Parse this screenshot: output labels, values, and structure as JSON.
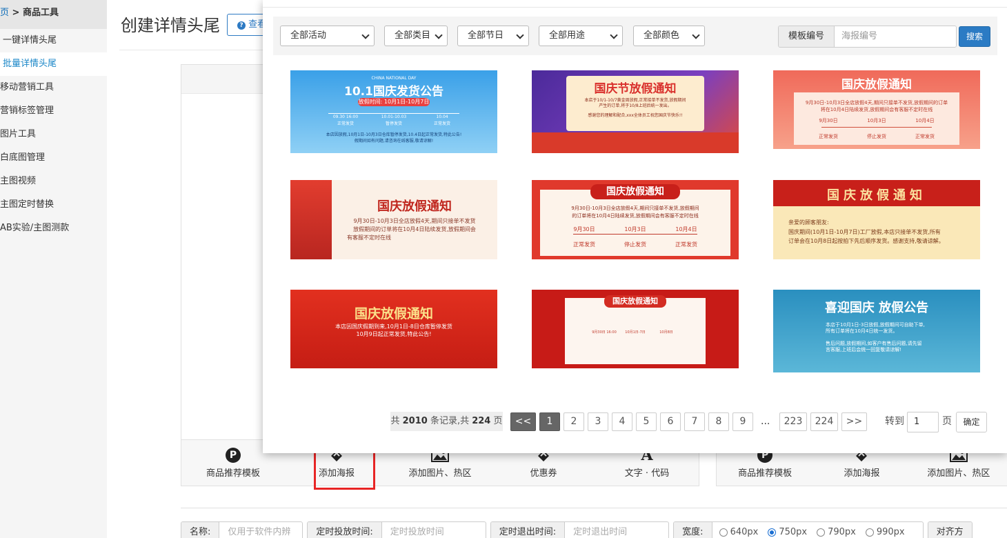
{
  "sidebar": {
    "breadcrumb_home": "页",
    "breadcrumb_sep": " > ",
    "breadcrumb_current": "商品工具",
    "items": [
      {
        "label": "一键详情头尾"
      },
      {
        "label": "批量详情头尾"
      },
      {
        "label": "移动营销工具"
      },
      {
        "label": "营销标签管理"
      },
      {
        "label": "图片工具"
      },
      {
        "label": "白底图管理"
      },
      {
        "label": "主图视频"
      },
      {
        "label": "主图定时替换"
      },
      {
        "label": "AB实验/主图测款"
      }
    ]
  },
  "main": {
    "title": "创建详情头尾",
    "view_button": "查看",
    "toolbar_left": [
      {
        "label": "商品推荐模板",
        "icon": "p-circle-icon"
      },
      {
        "label": "添加海报",
        "icon": "coupon-icon"
      },
      {
        "label": "添加图片、热区",
        "icon": "image-icon"
      },
      {
        "label": "优惠券",
        "icon": "coupon-icon"
      },
      {
        "label": "文字 · 代码",
        "icon": "text-icon"
      }
    ],
    "toolbar_right": [
      {
        "label": "商品推荐模板",
        "icon": "p-circle-icon"
      },
      {
        "label": "添加海报",
        "icon": "coupon-icon"
      },
      {
        "label": "添加图片、热区",
        "icon": "image-icon"
      }
    ],
    "form": {
      "name_label": "名称:",
      "name_placeholder": "仅用于软件内辨",
      "start_label": "定时投放时间:",
      "start_placeholder": "定时投放时间",
      "end_label": "定时退出时间:",
      "end_placeholder": "定时退出时间",
      "width_label": "宽度:",
      "width_options": [
        "640px",
        "750px",
        "790px",
        "990px"
      ],
      "width_selected": "750px",
      "align_label": "对齐方"
    }
  },
  "modal": {
    "filters": [
      "全部活动",
      "全部类目",
      "全部节日",
      "全部用途",
      "全部颜色"
    ],
    "search_addon": "模板编号",
    "search_placeholder": "海报编号",
    "search_button": "搜索",
    "templates": [
      {
        "title": "10.1国庆发货公告",
        "top": "CHINA NATIONAL DAY",
        "sub": "放假时间: 10月1日-10月7日",
        "dates": [
          "09.30 16:00",
          "10.01-10.03",
          "10.04"
        ],
        "states": [
          "正常发货",
          "暂停发货",
          "正常发货"
        ],
        "body": "本店因放假,10月1日-10月3日仓库暂停发货,10.4日起正常发货,特此公告!",
        "body2": "假期间如有问题,请咨询在线客服,敬请谅解!"
      },
      {
        "title": "国庆节放假通知",
        "body": "本店于10/1-10/7黄金周放假,正常接单不发货,放假期间",
        "body2": "产生的订单,将于10/8上班后统一发出。",
        "body3": "感谢您的理解和配合,xxx全体员工祝您国庆节快乐!!"
      },
      {
        "title": "国庆放假通知",
        "body": "9月30日-10月3日全店放假4天,期间只接单不发货,放假期间的订单",
        "body2": "将在10月4日陆续发货,放假期间会有客服不定时在线",
        "dates": [
          "9月30日",
          "10月3日",
          "10月4日"
        ],
        "states": [
          "正常发货",
          "停止发货",
          "正常发货"
        ]
      },
      {
        "title": "国庆放假通知",
        "body": "9月30日-10月3日全店放假4天,期间只接单不发货",
        "body2": "放假期间的订单将在10月4日陆续发货,放假期间会",
        "body3": "有客服不定时在线"
      },
      {
        "title": "国庆放假通知",
        "body": "9月30日-10月3日全店放假4天,期间只接单不发货,放假期间",
        "body2": "的订单将在10月4日陆续发货,放假期间会有客服不定时在线",
        "dates": [
          "9月30日",
          "10月3日",
          "10月4日"
        ],
        "states": [
          "正常发货",
          "停止发货",
          "正常发货"
        ]
      },
      {
        "title": "国庆放假通知",
        "body": "亲爱的顾客朋友:",
        "body2": "国庆期间(10月1日-10月7日)工厂放假,本店只接单不发货,所有",
        "body3": "订单会在10月8日起按拍下先后顺序发货。感谢支持,敬请谅解。"
      },
      {
        "title": "国庆放假通知",
        "body": "本店因国庆假期到来,10月1日-8日仓库暂停发货",
        "body2": "10月9日起正常发货,特此公告!"
      },
      {
        "title": "国庆放假通知",
        "dates": [
          "9月30日 16:00",
          "10月1日-7日",
          "10月8日"
        ]
      },
      {
        "title": "喜迎国庆 放假公告",
        "body": "本店于10月1日-3日放假,放假期间可自助下单,",
        "body2": "所有订单将在10月4日统一发货。",
        "body3": "售后问题,放假期间,如客户有售后问题,请先留言客服,上班后会统一回复敬请谅解!"
      }
    ],
    "pagination": {
      "info_prefix": "共 ",
      "total_records": "2010",
      "info_mid": " 条记录,共 ",
      "total_pages": "224",
      "info_suffix": " 页",
      "first": "<<",
      "pages": [
        "1",
        "2",
        "3",
        "4",
        "5",
        "6",
        "7",
        "8",
        "9"
      ],
      "dots": "...",
      "tail_pages": [
        "223",
        "224"
      ],
      "next": ">>",
      "goto_label": "转到",
      "goto_value": "1",
      "goto_unit": "页",
      "confirm": "确定"
    }
  },
  "colors": {
    "accent": "#2b7bc4",
    "sidebar_active": "#1b87c8",
    "highlight_box": "#e82525"
  }
}
